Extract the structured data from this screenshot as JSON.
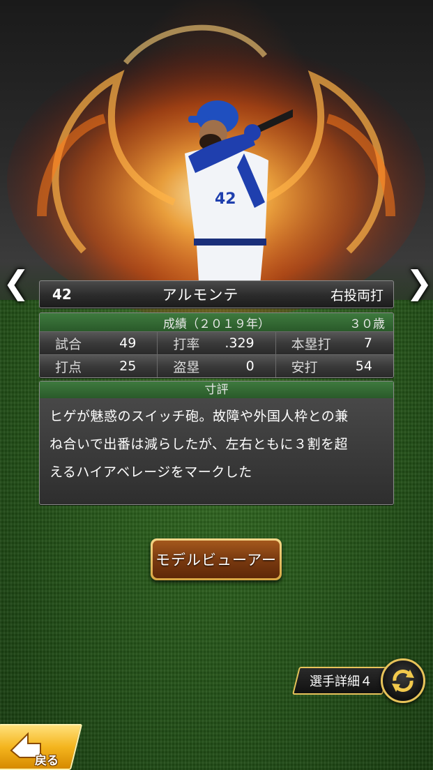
{
  "player": {
    "number": "42",
    "name": "アルモンテ",
    "handedness": "右投両打",
    "uniform_number": "42"
  },
  "stats": {
    "header": "成績（２０１９年）",
    "age": "３０歳",
    "rows": [
      [
        {
          "label": "試合",
          "value": "49"
        },
        {
          "label": "打率",
          "value": ".329"
        },
        {
          "label": "本塁打",
          "value": "7"
        }
      ],
      [
        {
          "label": "打点",
          "value": "25"
        },
        {
          "label": "盗塁",
          "value": "0"
        },
        {
          "label": "安打",
          "value": "54"
        }
      ]
    ]
  },
  "comment": {
    "header": "寸評",
    "lines": [
      "ヒゲが魅惑のスイッチ砲。故障や外国人枠との兼",
      "ね合いで出番は減らしたが、左右ともに３割を超",
      "えるハイアベレージをマークした"
    ]
  },
  "buttons": {
    "model_viewer": "モデルビューアー",
    "player_detail": "選手詳細４",
    "back": "戻る"
  },
  "nav": {
    "prev": "❮",
    "next": "❯"
  },
  "colors": {
    "panel_green": "#2a5a2a",
    "gold": "#e7c35a",
    "flame": "#ff8a1e"
  }
}
